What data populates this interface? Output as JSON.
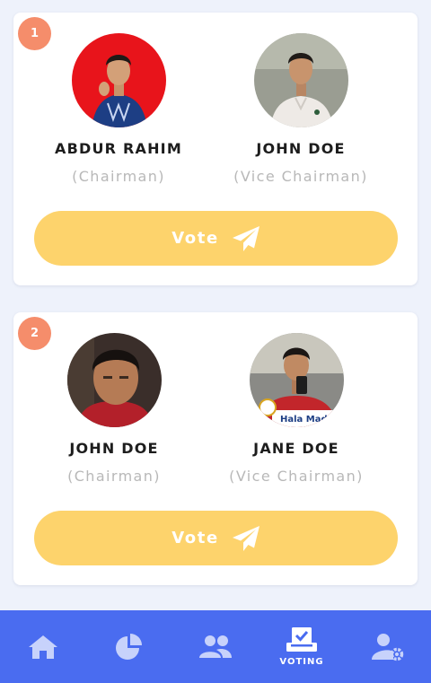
{
  "elections": [
    {
      "number": "1",
      "candidates": [
        {
          "name": "ABDUR RAHIM",
          "role": "(Chairman)"
        },
        {
          "name": "JOHN DOE",
          "role": "(Vice Chairman)"
        }
      ],
      "vote_label": "Vote"
    },
    {
      "number": "2",
      "candidates": [
        {
          "name": "JOHN DOE",
          "role": "(Chairman)"
        },
        {
          "name": "JANE DOE",
          "role": "(Vice Chairman)"
        }
      ],
      "vote_label": "Vote"
    }
  ],
  "photo_caption": "Hala Mad",
  "nav": {
    "items": [
      {
        "icon": "home-icon"
      },
      {
        "icon": "pie-chart-icon"
      },
      {
        "icon": "users-icon"
      },
      {
        "icon": "ballot-check-icon",
        "label": "VOTING",
        "active": true
      },
      {
        "icon": "user-settings-icon"
      }
    ]
  },
  "colors": {
    "background": "#eef2fb",
    "badge": "#f58d6b",
    "vote_button": "#fdd36c",
    "nav_bar": "#4a6cf0",
    "nav_icon_inactive": "#c7d2fb"
  }
}
